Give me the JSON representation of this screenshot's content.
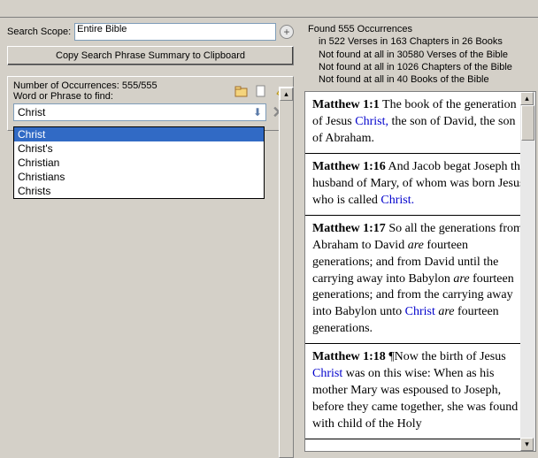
{
  "search": {
    "scope_label": "Search Scope:",
    "scope_value": "Entire Bible",
    "copy_button": "Copy Search Phrase Summary to Clipboard",
    "occurrences_label": "Number of Occurrences: 555/555",
    "phrase_label": "Word or Phrase to find:",
    "phrase_value": "Christ"
  },
  "dropdown": {
    "items": [
      "Christ",
      "Christ's",
      "Christian",
      "Christians",
      "Christs"
    ],
    "selected_index": 0
  },
  "stats": {
    "line1": "Found 555 Occurrences",
    "line2": "in 522 Verses in 163 Chapters in 26 Books",
    "line3": "Not found at all in 30580 Verses of the Bible",
    "line4": "Not found at all in 1026 Chapters of the Bible",
    "line5": "Not found at all in 40 Books of the Bible"
  },
  "results": [
    {
      "ref": "Matthew 1:1",
      "parts": [
        {
          "t": " The book of the generation of Jesus "
        },
        {
          "t": "Christ,",
          "kw": true
        },
        {
          "t": " the son of David, the son of Abraham."
        }
      ]
    },
    {
      "ref": "Matthew 1:16",
      "parts": [
        {
          "t": " And Jacob begat Joseph the husband of Mary, of whom was born Jesus, who is called "
        },
        {
          "t": "Christ.",
          "kw": true
        }
      ]
    },
    {
      "ref": "Matthew 1:17",
      "parts": [
        {
          "t": " So all the generations from Abraham to David "
        },
        {
          "t": "are",
          "it": true
        },
        {
          "t": " fourteen generations; and from David until the carrying away into Babylon "
        },
        {
          "t": "are",
          "it": true
        },
        {
          "t": " fourteen generations; and from the carrying away into Babylon unto "
        },
        {
          "t": "Christ",
          "kw": true
        },
        {
          "t": " "
        },
        {
          "t": "are",
          "it": true
        },
        {
          "t": " fourteen generations."
        }
      ]
    },
    {
      "ref": "Matthew 1:18",
      "parts": [
        {
          "t": " ¶Now the birth of Jesus "
        },
        {
          "t": "Christ",
          "kw": true
        },
        {
          "t": " was on this wise: When as his mother Mary was espoused to Joseph, before they came together, she was found with child of the Holy"
        }
      ]
    }
  ]
}
